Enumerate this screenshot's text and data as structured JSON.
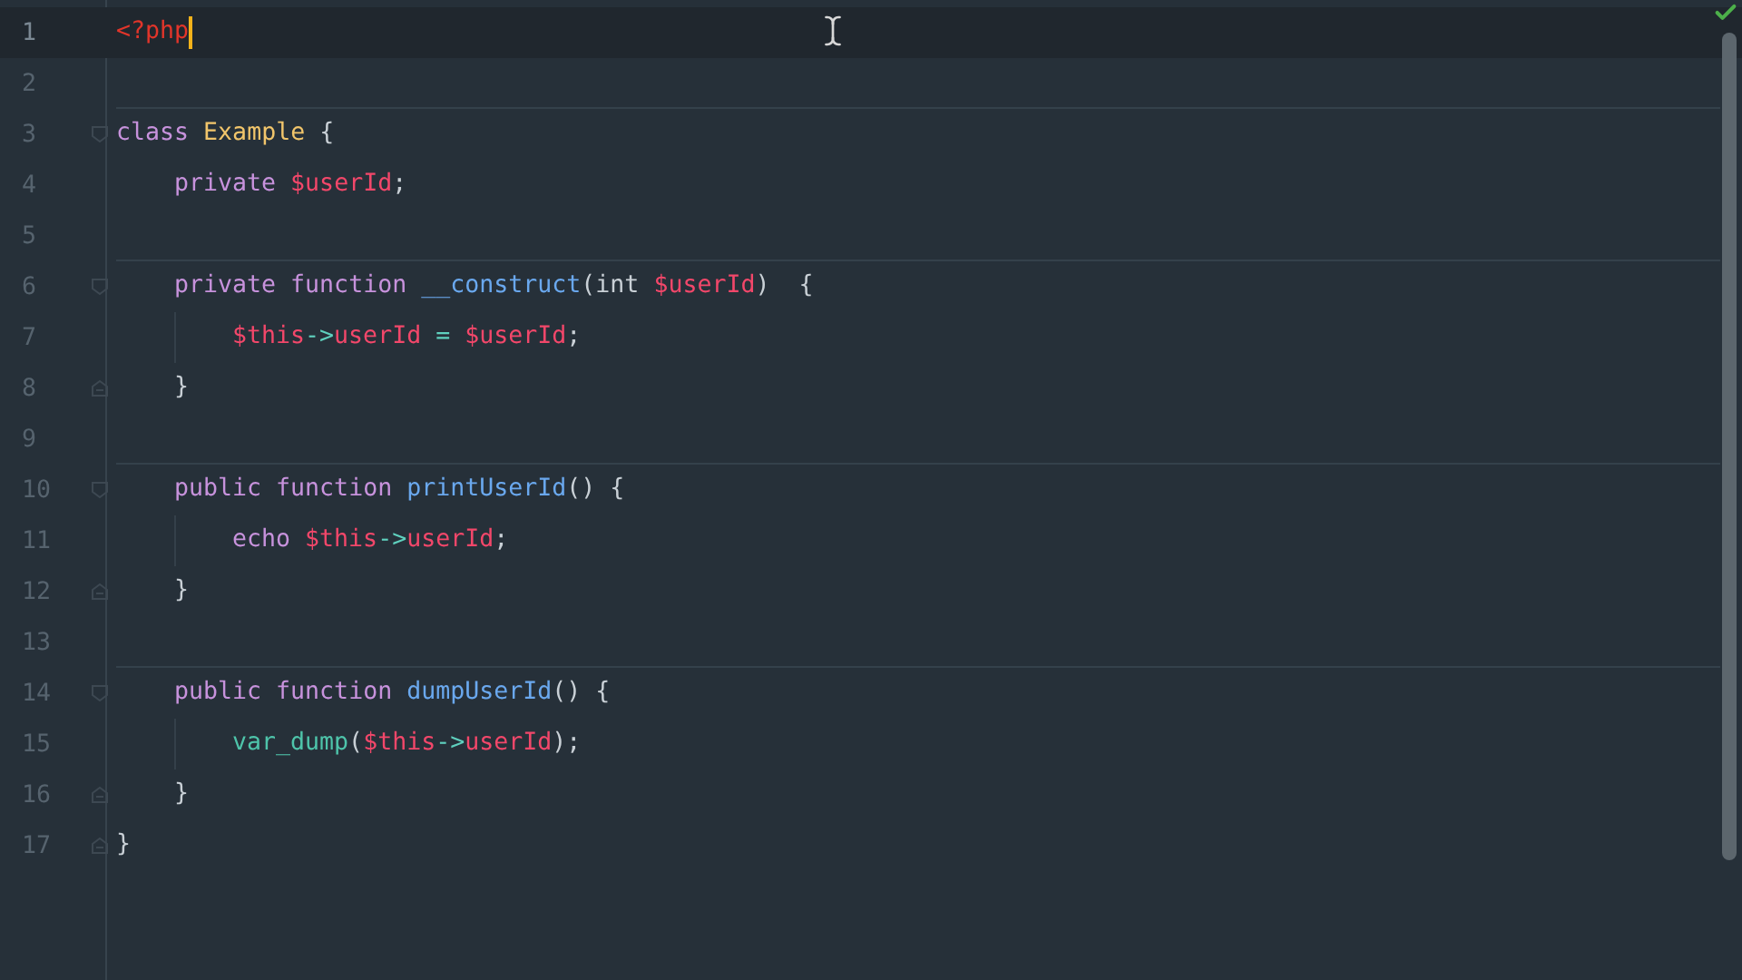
{
  "editor": {
    "lines": [
      {
        "number": "1",
        "current": true,
        "caret": true,
        "separator": false,
        "fold_start": false,
        "fold_end": false,
        "tokens": [
          {
            "text": "<?php",
            "kind": "tag"
          }
        ]
      },
      {
        "number": "2",
        "current": false,
        "caret": false,
        "separator": true,
        "fold_start": false,
        "fold_end": false
      },
      {
        "number": "3",
        "current": false,
        "caret": false,
        "separator": false,
        "fold_start": true,
        "fold_end": false,
        "tokens": [
          {
            "text": "class ",
            "kind": "keyword"
          },
          {
            "text": "Example",
            "kind": "type"
          },
          {
            "text": " {",
            "kind": "plain"
          }
        ],
        "children": [
          {
            "number": "4",
            "current": false,
            "caret": false,
            "separator": false,
            "fold_start": false,
            "fold_end": false,
            "tokens": [
              {
                "text": "private ",
                "kind": "keyword"
              },
              {
                "text": "$userId",
                "kind": "variable"
              },
              {
                "text": ";",
                "kind": "plain"
              }
            ]
          },
          {
            "number": "5",
            "current": false,
            "caret": false,
            "separator": true,
            "fold_start": false,
            "fold_end": false
          },
          {
            "number": "6",
            "current": false,
            "caret": false,
            "separator": false,
            "fold_start": true,
            "fold_end": false,
            "tokens": [
              {
                "text": "private function ",
                "kind": "keyword"
              },
              {
                "text": "__construct",
                "kind": "function"
              },
              {
                "text": "(int ",
                "kind": "plain"
              },
              {
                "text": "$userId",
                "kind": "variable"
              },
              {
                "text": ")  {",
                "kind": "plain"
              }
            ],
            "children": [
              {
                "number": "7",
                "current": false,
                "caret": false,
                "separator": false,
                "fold_start": false,
                "fold_end": false,
                "tokens": [
                  {
                    "text": "$this",
                    "kind": "variable"
                  },
                  {
                    "text": "->",
                    "kind": "operator"
                  },
                  {
                    "text": "userId",
                    "kind": "variable"
                  },
                  {
                    "text": " = ",
                    "kind": "operator"
                  },
                  {
                    "text": "$userId",
                    "kind": "variable"
                  },
                  {
                    "text": ";",
                    "kind": "plain"
                  }
                ]
              }
            ]
          },
          {
            "number": "8",
            "current": false,
            "caret": false,
            "separator": false,
            "fold_start": false,
            "fold_end": true,
            "tokens": [
              {
                "text": "}",
                "kind": "plain"
              }
            ]
          },
          {
            "number": "9",
            "current": false,
            "caret": false,
            "separator": true,
            "fold_start": false,
            "fold_end": false
          },
          {
            "number": "10",
            "current": false,
            "caret": false,
            "separator": false,
            "fold_start": true,
            "fold_end": false,
            "tokens": [
              {
                "text": "public function ",
                "kind": "keyword"
              },
              {
                "text": "printUserId",
                "kind": "function"
              },
              {
                "text": "() {",
                "kind": "plain"
              }
            ],
            "children": [
              {
                "number": "11",
                "current": false,
                "caret": false,
                "separator": false,
                "fold_start": false,
                "fold_end": false,
                "tokens": [
                  {
                    "text": "echo ",
                    "kind": "keyword"
                  },
                  {
                    "text": "$this",
                    "kind": "variable"
                  },
                  {
                    "text": "->",
                    "kind": "operator"
                  },
                  {
                    "text": "userId",
                    "kind": "variable"
                  },
                  {
                    "text": ";",
                    "kind": "plain"
                  }
                ]
              }
            ]
          },
          {
            "number": "12",
            "current": false,
            "caret": false,
            "separator": false,
            "fold_start": false,
            "fold_end": true,
            "tokens": [
              {
                "text": "}",
                "kind": "plain"
              }
            ]
          },
          {
            "number": "13",
            "current": false,
            "caret": false,
            "separator": true,
            "fold_start": false,
            "fold_end": false
          },
          {
            "number": "14",
            "current": false,
            "caret": false,
            "separator": false,
            "fold_start": true,
            "fold_end": false,
            "tokens": [
              {
                "text": "public function ",
                "kind": "keyword"
              },
              {
                "text": "dumpUserId",
                "kind": "function"
              },
              {
                "text": "() {",
                "kind": "plain"
              }
            ],
            "children": [
              {
                "number": "15",
                "current": false,
                "caret": false,
                "separator": false,
                "fold_start": false,
                "fold_end": false,
                "tokens": [
                  {
                    "text": "var_dump",
                    "kind": "builtin"
                  },
                  {
                    "text": "(",
                    "kind": "plain"
                  },
                  {
                    "text": "$this",
                    "kind": "variable"
                  },
                  {
                    "text": "->",
                    "kind": "operator"
                  },
                  {
                    "text": "userId",
                    "kind": "variable"
                  },
                  {
                    "text": ");",
                    "kind": "plain"
                  }
                ]
              }
            ]
          },
          {
            "number": "16",
            "current": false,
            "caret": false,
            "separator": false,
            "fold_start": false,
            "fold_end": true,
            "tokens": [
              {
                "text": "}",
                "kind": "plain"
              }
            ]
          }
        ]
      },
      {
        "number": "17",
        "current": false,
        "caret": false,
        "separator": false,
        "fold_start": false,
        "fold_end": true,
        "tokens": [
          {
            "text": "}",
            "kind": "plain"
          }
        ]
      }
    ]
  }
}
